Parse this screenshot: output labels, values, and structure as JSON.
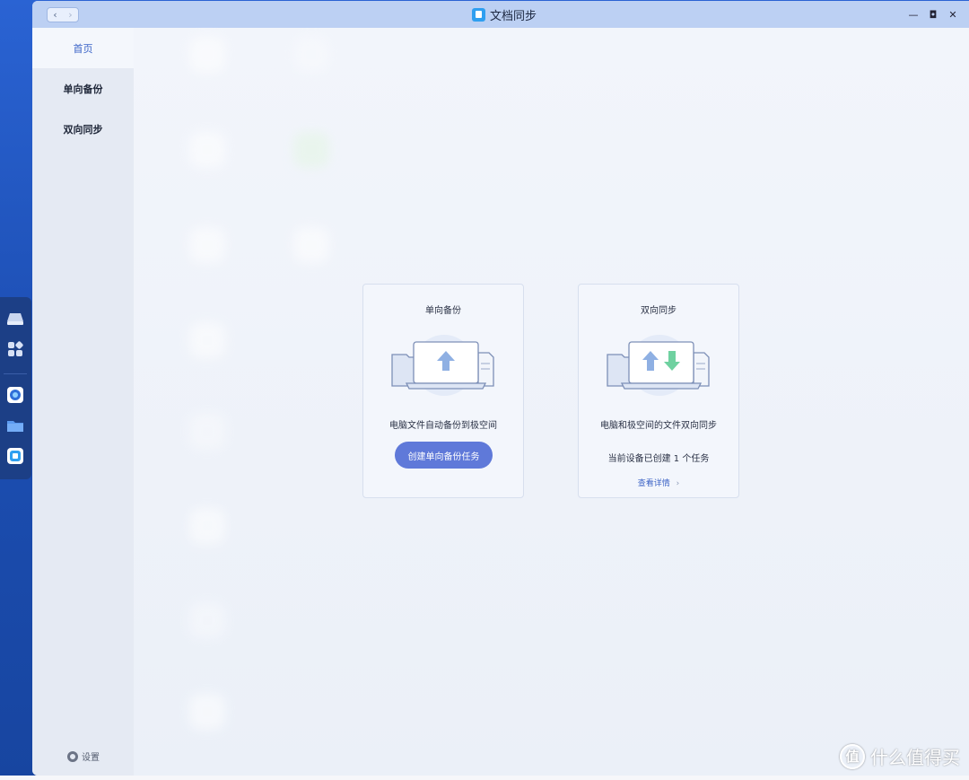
{
  "window": {
    "title": "文档同步"
  },
  "nav": {
    "back": "‹",
    "forward": "›"
  },
  "window_controls": {
    "minimize": "—",
    "maximize": "◘",
    "close": "✕"
  },
  "sidebar": {
    "items": [
      {
        "label": "首页",
        "active": true
      },
      {
        "label": "单向备份",
        "active": false
      },
      {
        "label": "双向同步",
        "active": false
      }
    ],
    "settings_label": "设置"
  },
  "cards": {
    "backup": {
      "title": "单向备份",
      "description": "电脑文件自动备份到极空间",
      "button_label": "创建单向备份任务"
    },
    "sync": {
      "title": "双向同步",
      "description": "电脑和极空间的文件双向同步",
      "status": "当前设备已创建 1 个任务",
      "link_label": "查看详情",
      "link_chevron": "›"
    }
  },
  "watermark": {
    "logo_char": "值",
    "text": "什么值得买"
  },
  "colors": {
    "accent": "#5f79d9",
    "link": "#3d64c6",
    "titlebar": "#bcd0f3",
    "arrow_up": "#8fb0e3",
    "arrow_down": "#6fd1a0"
  },
  "dock": {
    "icons": [
      "drive-icon",
      "apps-grid-icon",
      "browser-icon",
      "folder-icon",
      "doc-sync-icon"
    ]
  }
}
